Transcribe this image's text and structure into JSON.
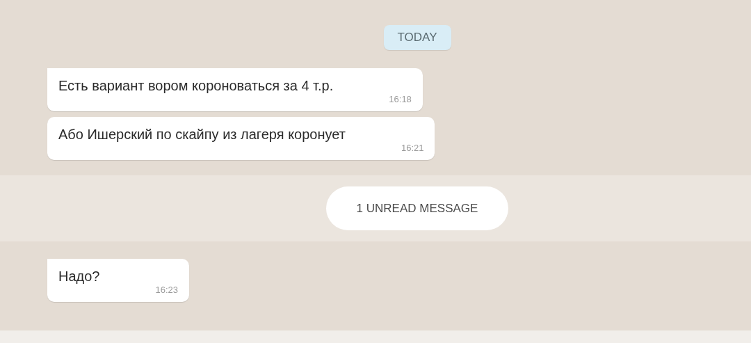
{
  "items": [
    {
      "kind": "date",
      "text": "TODAY"
    },
    {
      "kind": "message",
      "text": "Есть вариант вором короноваться за 4 т.р.",
      "time": "16:18",
      "tail": true
    },
    {
      "kind": "message",
      "text": "Або Ишерский по скайпу из лагеря коронует",
      "time": "16:21",
      "tail": false
    },
    {
      "kind": "unread",
      "text": "1 UNREAD MESSAGE"
    },
    {
      "kind": "message",
      "text": "Надо?",
      "time": "16:23",
      "tail": true
    }
  ]
}
